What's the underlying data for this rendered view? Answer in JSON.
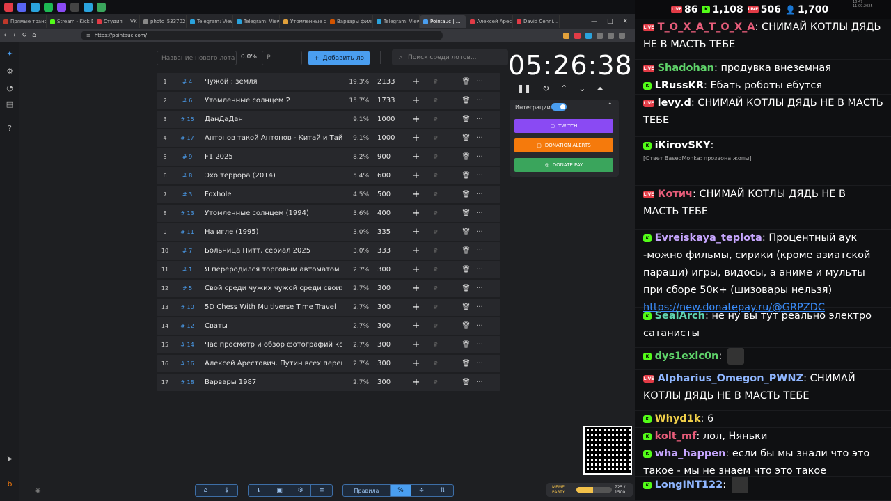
{
  "browser": {
    "tabs": [
      {
        "label": "Прямые трансл.",
        "color": "#c0392b"
      },
      {
        "label": "Stream - Kick D.",
        "color": "#53fc18"
      },
      {
        "label": "Студия — VK В.",
        "color": "#e23b46"
      },
      {
        "label": "photo_533702...",
        "color": "#888888"
      },
      {
        "label": "Telegram: View...",
        "color": "#2aa3dd"
      },
      {
        "label": "Telegram: View...",
        "color": "#2aa3dd"
      },
      {
        "label": "Утомленные с...",
        "color": "#e2a13b"
      },
      {
        "label": "Варвары филь...",
        "color": "#d35400"
      },
      {
        "label": "Telegram: View...",
        "color": "#2aa3dd"
      },
      {
        "label": "Pointauc | ...",
        "color": "#4a9ef0",
        "active": true
      },
      {
        "label": "Алексей Арест...",
        "color": "#e23b46"
      },
      {
        "label": "David Cenni...",
        "color": "#e23b46"
      }
    ],
    "url": "https://pointauc.com/",
    "window_controls": [
      "—",
      "□",
      "✕"
    ]
  },
  "auction": {
    "new_lot_placeholder": "Название нового лота",
    "new_lot_percent": "0.0%",
    "new_lot_amount_placeholder": "₽",
    "add_button": "Добавить ло",
    "add_icon": "+",
    "search_placeholder": "Поиск среди лотов...",
    "search_icon": "⌕",
    "lots": [
      {
        "index": "1",
        "id": "# 4",
        "name": "Чужой : земля",
        "percent": "19.3%",
        "amount": "2133"
      },
      {
        "index": "2",
        "id": "# 6",
        "name": "Утомленные солнцем 2",
        "percent": "15.7%",
        "amount": "1733"
      },
      {
        "index": "3",
        "id": "# 15",
        "name": "ДанДаДан",
        "percent": "9.1%",
        "amount": "1000"
      },
      {
        "index": "4",
        "id": "# 17",
        "name": "Антонов такой Антонов - Китай и Тайвань",
        "percent": "9.1%",
        "amount": "1000"
      },
      {
        "index": "5",
        "id": "# 9",
        "name": "F1 2025",
        "percent": "8.2%",
        "amount": "900"
      },
      {
        "index": "6",
        "id": "# 8",
        "name": "Эхо террора (2014)",
        "percent": "5.4%",
        "amount": "600"
      },
      {
        "index": "7",
        "id": "# 3",
        "name": "Foxhole",
        "percent": "4.5%",
        "amount": "500"
      },
      {
        "index": "8",
        "id": "# 13",
        "name": "Утомленные солнцем (1994)",
        "percent": "3.6%",
        "amount": "400"
      },
      {
        "index": "9",
        "id": "# 11",
        "name": "На игле (1995)",
        "percent": "3.0%",
        "amount": "335"
      },
      {
        "index": "10",
        "id": "# 7",
        "name": "Больница Питт, сериал 2025",
        "percent": "3.0%",
        "amount": "333"
      },
      {
        "index": "11",
        "id": "# 1",
        "name": "Я переродился торговым автоматом и ск",
        "percent": "2.7%",
        "amount": "300"
      },
      {
        "index": "12",
        "id": "# 5",
        "name": "Свой среди чужих чужой среди своих",
        "percent": "2.7%",
        "amount": "300"
      },
      {
        "index": "13",
        "id": "# 10",
        "name": "5D Chess With Multiverse Time Travel",
        "percent": "2.7%",
        "amount": "300"
      },
      {
        "index": "14",
        "id": "# 12",
        "name": "Сваты",
        "percent": "2.7%",
        "amount": "300"
      },
      {
        "index": "15",
        "id": "# 14",
        "name": "Час просмотр и обзор фотографий котов",
        "percent": "2.7%",
        "amount": "300"
      },
      {
        "index": "16",
        "id": "# 16",
        "name": "Алексей Арестович. Путин всех переигра",
        "percent": "2.7%",
        "amount": "300"
      },
      {
        "index": "17",
        "id": "# 18",
        "name": "Варвары 1987",
        "percent": "2.7%",
        "amount": "300"
      }
    ],
    "row_glyphs": {
      "plus": "+",
      "currency": "₽",
      "delete": "🗑",
      "more": "···"
    }
  },
  "timer": {
    "value": "05:26:38",
    "controls": {
      "pause": "❚❚",
      "reset": "↻",
      "up": "⌃",
      "down": "⌄",
      "top": "⏶"
    }
  },
  "integrations": {
    "label": "Интеграции",
    "collapse": "⌃",
    "buttons": [
      {
        "label": "TWITCH",
        "color": "#8a4af3"
      },
      {
        "label": "DONATION ALERTS",
        "color": "#f57a0c"
      },
      {
        "label": "DONATE PAY",
        "color": "#3aa55c"
      }
    ]
  },
  "bottom_toolbar": {
    "group1": [
      "⌂",
      "$"
    ],
    "group2": [
      "⭳",
      "▣",
      "⚙",
      "≡"
    ],
    "rules_label": "Правила",
    "group3": [
      "%",
      "÷",
      "⇅"
    ]
  },
  "meme_party": {
    "label": "MEME PARTY",
    "count": "725 / 1500",
    "progress": 0.48
  },
  "chat": {
    "stats": [
      {
        "platform": "LIVE",
        "value": "86"
      },
      {
        "platform": "K",
        "value": "1,108"
      },
      {
        "platform": "LIVE",
        "value": "506"
      },
      {
        "platform": "users",
        "value": "1,700"
      }
    ],
    "clock_time": "18:47",
    "clock_date": "11.09.2025",
    "messages": [
      {
        "platform": "LIVE",
        "nick": "T_O_X_A_T_O_X_A",
        "color": "#e85d7a",
        "text": "СНИМАЙ КОТЛЫ ДЯДЬ НЕ В МАСТЬ ТЕБЕ"
      },
      {
        "platform": "LIVE",
        "nick": "Shadohan",
        "color": "#5fd36a",
        "text": "продувка внеземная"
      },
      {
        "platform": "K",
        "nick": "LRussKR",
        "color": "#ffffff",
        "text": "Ебать роботы ебутся"
      },
      {
        "platform": "LIVE",
        "nick": "levy.d",
        "color": "#ffffff",
        "text": "СНИМАЙ КОТЛЫ ДЯДЬ НЕ В МАСТЬ ТЕБЕ"
      },
      {
        "platform": "K",
        "nick": "iKirovSKY",
        "color": "#ffffff",
        "reply": "[Ответ BasedMonka: прозвона жопы]",
        "text": ""
      },
      {
        "platform": "LIVE",
        "nick": "Котич",
        "color": "#e85d7a",
        "text": "СНИМАЙ КОТЛЫ ДЯДЬ НЕ В МАСТЬ ТЕБЕ"
      },
      {
        "platform": "K",
        "nick": "Evreiskaya_teplota",
        "color": "#c7a6ff",
        "text": "Процентный аук -можно фильмы, сирики (кроме азиатской параши) игры, видосы, а аниме и мульты при сборе 50к+ (шизовары нельзя)",
        "link": "https://new.donatepay.ru/@GRPZDC"
      },
      {
        "platform": "K",
        "nick": "SealArch",
        "color": "#5fd3b0",
        "text": "не ну вы тут реально электро сатанисты"
      },
      {
        "platform": "K",
        "nick": "dys1exic0n",
        "color": "#5fd36a",
        "text": ""
      },
      {
        "platform": "LIVE",
        "nick": "Alpharius_Omegon_PWNZ",
        "color": "#8fb6ff",
        "text": "СНИМАЙ КОТЛЫ ДЯДЬ НЕ В МАСТЬ ТЕБЕ"
      },
      {
        "platform": "K",
        "nick": "Whyd1k",
        "color": "#f3d24a",
        "text": "6"
      },
      {
        "platform": "K",
        "nick": "kolt_mf",
        "color": "#e85d7a",
        "text": "лол, Няньки"
      },
      {
        "platform": "K",
        "nick": "wha_happen",
        "color": "#c7a6ff",
        "text": "если бы мы знали что это такое - мы не знаем что это такое"
      },
      {
        "platform": "K",
        "nick": "LongINT122",
        "color": "#8fb6ff",
        "text": ""
      }
    ]
  }
}
